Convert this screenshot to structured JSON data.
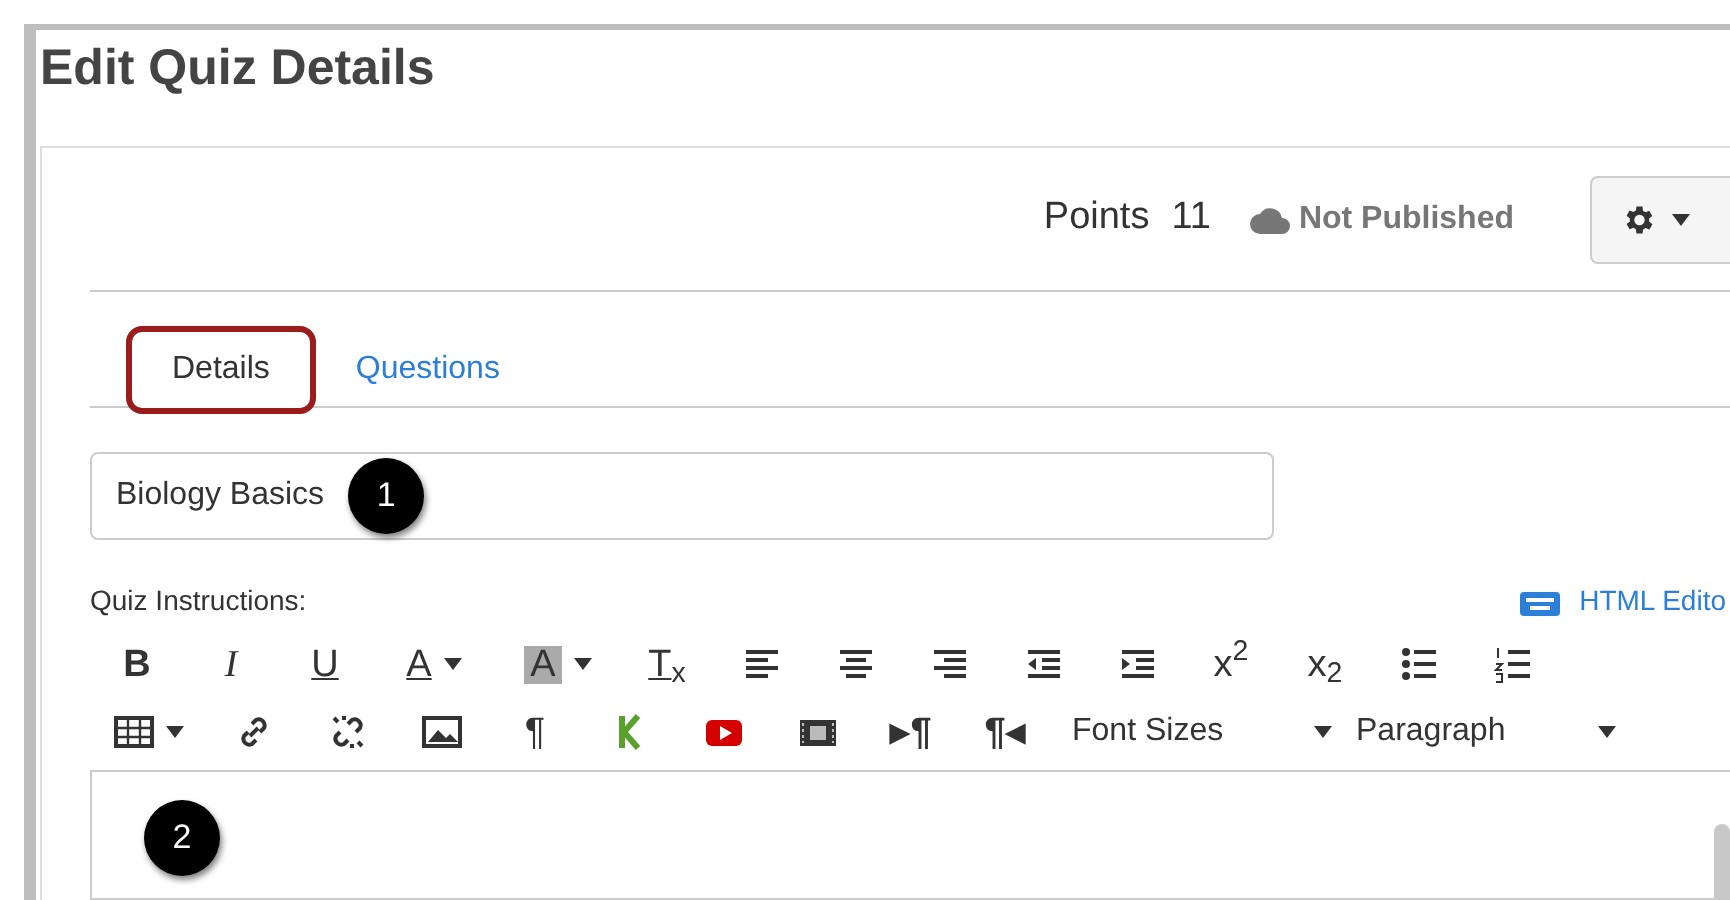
{
  "page_title": "Edit Quiz Details",
  "header": {
    "points_label": "Points",
    "points_value": "11",
    "publish_status": "Not Published",
    "published": false
  },
  "tabs": [
    {
      "label": "Details",
      "selected": true
    },
    {
      "label": "Questions",
      "selected": false
    }
  ],
  "title_field": {
    "value": "Biology Basics",
    "callout": "1"
  },
  "instructions": {
    "label": "Quiz Instructions:",
    "html_editor_link": "HTML Edito",
    "callout": "2"
  },
  "toolbar_rows": [
    [
      {
        "kind": "glyph",
        "text": "B"
      },
      {
        "kind": "glyph",
        "text": "I"
      },
      {
        "kind": "glyph",
        "text": "U"
      },
      {
        "kind": "glyph",
        "text": "A"
      },
      {
        "kind": "glyph",
        "text": "A"
      },
      {
        "kind": "glyph",
        "text": "T$_{x}$"
      },
      {
        "kind": "icon"
      },
      {
        "kind": "icon"
      },
      {
        "kind": "icon"
      },
      {
        "kind": "icon"
      },
      {
        "kind": "icon"
      },
      {
        "kind": "glyph",
        "text": "x$^{2}$"
      },
      {
        "kind": "glyph",
        "text": "x$_{2}$"
      },
      {
        "kind": "icon"
      },
      {
        "kind": "icon"
      }
    ],
    [
      {
        "kind": "icon"
      },
      {
        "kind": "icon"
      },
      {
        "kind": "icon"
      },
      {
        "kind": "icon"
      },
      {
        "kind": "glyph",
        "text": "¶"
      },
      {
        "kind": "icon"
      },
      {
        "kind": "icon"
      },
      {
        "kind": "icon"
      },
      {
        "kind": "glyph",
        "text": "▸¶"
      },
      {
        "kind": "glyph",
        "text": "¶◂"
      },
      {
        "kind": "dropdown",
        "text": "Font Sizes"
      },
      {
        "kind": "dropdown",
        "text": "Paragraph"
      }
    ]
  ]
}
